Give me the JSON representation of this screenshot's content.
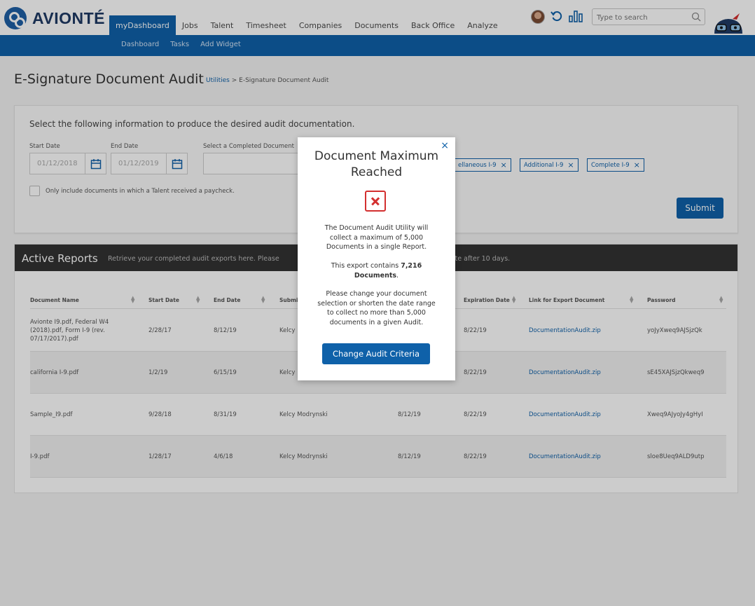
{
  "app": {
    "logo_text": "AVIONTÉ"
  },
  "nav": {
    "items": [
      "myDashboard",
      "Jobs",
      "Talent",
      "Timesheet",
      "Companies",
      "Documents",
      "Back Office",
      "Analyze"
    ],
    "active": "myDashboard"
  },
  "subnav": {
    "items": [
      "Dashboard",
      "Tasks",
      "Add Widget"
    ]
  },
  "search": {
    "placeholder": "Type to search"
  },
  "page": {
    "title": "E-Signature Document Audit",
    "breadcrumb_link": "Utilities",
    "breadcrumb_sep": " > ",
    "breadcrumb_current": "E-Signature Document Audit"
  },
  "form": {
    "intro": "Select the following information to produce the desired audit documentation.",
    "start_label": "Start Date",
    "start_value": "01/12/2018",
    "end_label": "End Date",
    "end_value": "01/12/2019",
    "select_label": "Select a Completed Document",
    "chips": [
      "ellaneous I-9",
      "Additional I-9",
      "Complete I-9"
    ],
    "checkbox_label": "Only include documents in which a Talent received a paycheck.",
    "submit_label": "Submit"
  },
  "reports": {
    "title": "Active Reports",
    "subtitle_left": "Retrieve your completed audit exports here. Please",
    "subtitle_right": "ete after 10 days.",
    "columns": [
      "Document Name",
      "Start Date",
      "End Date",
      "Submi",
      "Expiration Date",
      "Link for Export Document",
      "Password"
    ],
    "rows": [
      {
        "name": "Avionte I9.pdf, Federal W4 (2018).pdf, Form I-9 (rev. 07/17/2017).pdf",
        "start": "2/28/17",
        "end": "8/12/19",
        "submitted_by": "Kelcy",
        "created": "",
        "expiration": "8/22/19",
        "link": "DocumentationAudit.zip",
        "password": "yoJyXweq9AJSjzQk"
      },
      {
        "name": "california I-9.pdf",
        "start": "1/2/19",
        "end": "6/15/19",
        "submitted_by": "Kelcy",
        "created": "",
        "expiration": "8/22/19",
        "link": "DocumentationAudit.zip",
        "password": "sE45XAJSjzQkweq9"
      },
      {
        "name": "Sample_I9.pdf",
        "start": "9/28/18",
        "end": "8/31/19",
        "submitted_by": "Kelcy Modrynski",
        "created": "8/12/19",
        "expiration": "8/22/19",
        "link": "DocumentationAudit.zip",
        "password": "Xweq9AJyoJy4gHyI"
      },
      {
        "name": "I-9.pdf",
        "start": "1/28/17",
        "end": "4/6/18",
        "submitted_by": "Kelcy Modrynski",
        "created": "8/12/19",
        "expiration": "8/22/19",
        "link": "DocumentationAudit.zip",
        "password": "sloe8Ueq9ALD9utp"
      }
    ]
  },
  "modal": {
    "close": "×",
    "title": "Document Maximum Reached",
    "p1": "The Document Audit Utility will collect a maximum of 5,000 Documents in a single Report.",
    "p2_prefix": "This export contains ",
    "p2_bold": "7,216 Documents",
    "p2_suffix": ".",
    "p3": "Please change your document selection or shorten the date range to collect no more than 5,000 documents in a given Audit.",
    "button": "Change Audit Criteria"
  },
  "icons": [
    "avatar",
    "refresh-icon",
    "analytics-icon",
    "search-icon",
    "mascot-icon",
    "calendar-icon",
    "close-icon",
    "error-icon"
  ],
  "colors": {
    "brand_blue": "#0f61a9",
    "header_dark": "#333333",
    "error_red": "#d32f2f",
    "logo_navy": "#1f3a64"
  }
}
